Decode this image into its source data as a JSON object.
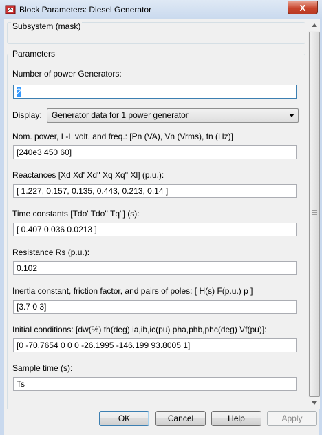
{
  "window": {
    "title": "Block Parameters: Diesel Generator",
    "close_glyph": "X"
  },
  "subsystem": {
    "text": "Subsystem (mask)"
  },
  "parameters": {
    "group_title": "Parameters",
    "num_generators": {
      "label": "Number of power Generators:",
      "value": "2"
    },
    "display": {
      "label": "Display:",
      "value": "Generator data for 1 power generator"
    },
    "nom_power": {
      "label": "Nom. power, L-L volt. and freq.: [Pn (VA), Vn (Vrms), fn (Hz)]",
      "value": "[240e3 450 60]"
    },
    "reactances": {
      "label": "Reactances [Xd Xd' Xd'' Xq Xq'' Xl] (p.u.):",
      "value": "[ 1.227, 0.157, 0.135, 0.443,  0.213,  0.14 ]"
    },
    "time_constants": {
      "label": "Time constants [Tdo' Tdo'' Tq''] (s):",
      "value": "[  0.407  0.036  0.0213  ]"
    },
    "resistance": {
      "label": "Resistance Rs (p.u.):",
      "value": "0.102"
    },
    "inertia": {
      "label": "Inertia constant, friction factor, and pairs of poles: [ H(s)  F(p.u.)  p ]",
      "value": "[3.7 0 3]"
    },
    "initial_conditions": {
      "label": "Initial conditions: [dw(%) th(deg) ia,ib,ic(pu) pha,phb,phc(deg) Vf(pu)]:",
      "value": "[0 -70.7654 0 0 0 -26.1995 -146.199 93.8005 1]"
    },
    "sample_time": {
      "label": "Sample time (s):",
      "value": "Ts"
    }
  },
  "buttons": {
    "ok": "OK",
    "cancel": "Cancel",
    "help": "Help",
    "apply": "Apply"
  }
}
